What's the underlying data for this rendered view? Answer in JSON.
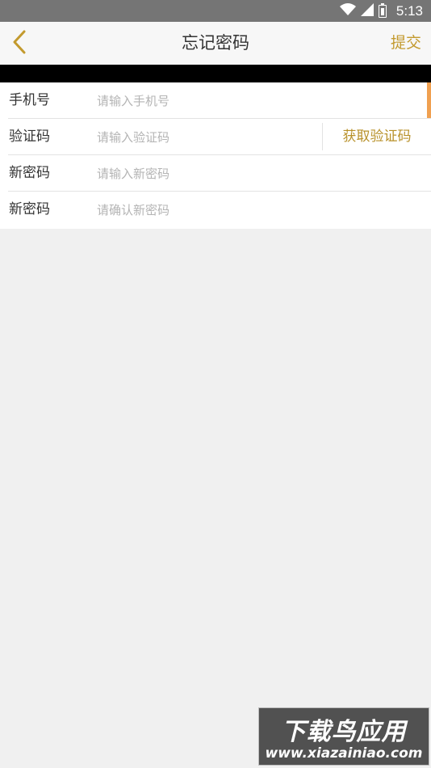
{
  "status_bar": {
    "time": "5:13",
    "icons": [
      "wifi-icon",
      "cellular-signal-icon",
      "battery-charging-icon"
    ]
  },
  "header": {
    "back_icon": "chevron-left-icon",
    "title": "忘记密码",
    "submit_label": "提交"
  },
  "form": {
    "rows": [
      {
        "label": "手机号",
        "placeholder": "请输入手机号",
        "value": ""
      },
      {
        "label": "验证码",
        "placeholder": "请输入验证码",
        "value": "",
        "action_label": "获取验证码"
      },
      {
        "label": "新密码",
        "placeholder": "请输入新密码",
        "value": ""
      },
      {
        "label": "新密码",
        "placeholder": "请确认新密码",
        "value": ""
      }
    ]
  },
  "watermark": {
    "title": "下载鸟应用",
    "url": "www.xiazainiao.com"
  },
  "colors": {
    "accent": "#c39a2e",
    "status_bar": "#757575",
    "focus_indicator": "#f0a050",
    "background": "#f0f0f0"
  }
}
